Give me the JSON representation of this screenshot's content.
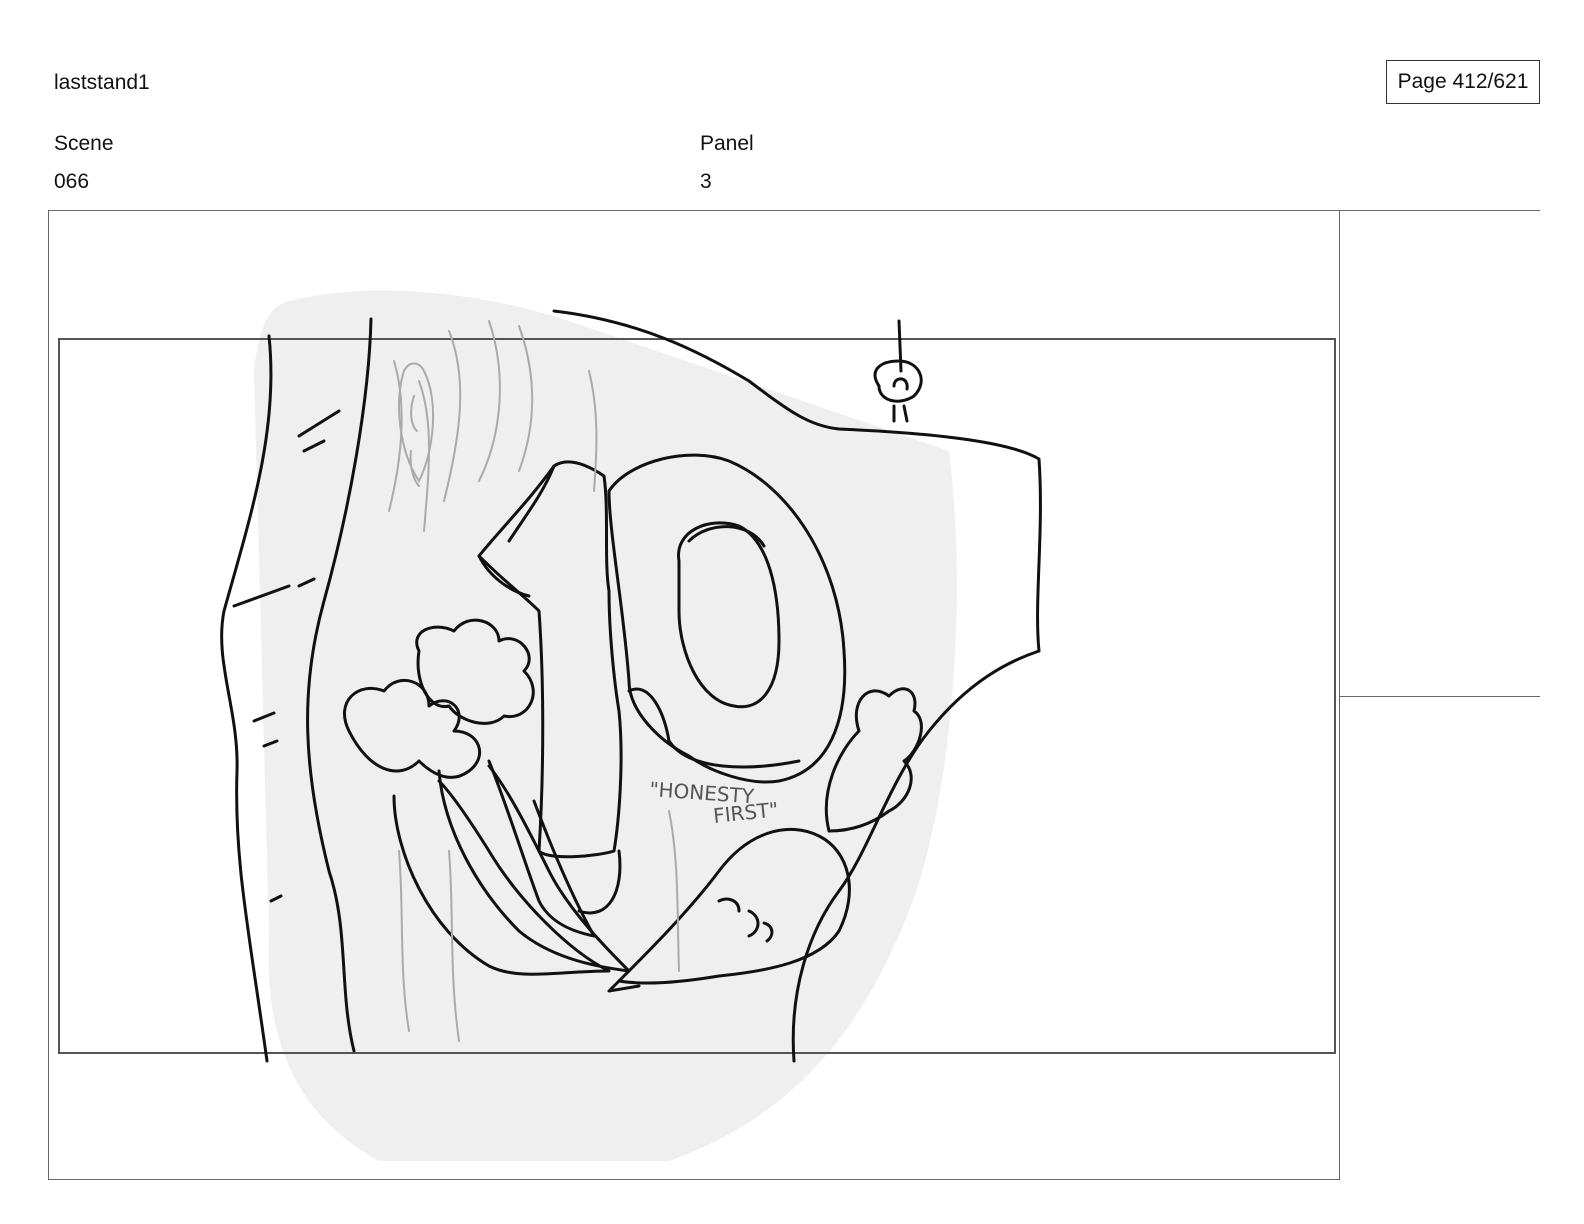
{
  "header": {
    "project_title": "laststand1",
    "page_counter": "Page 412/621"
  },
  "fields": {
    "scene_label": "Scene",
    "scene_value": "066",
    "panel_label": "Panel",
    "panel_value": "3"
  },
  "sketch": {
    "sign_text_line1": "\"HONESTY",
    "sign_text_line2": "FIRST\""
  }
}
